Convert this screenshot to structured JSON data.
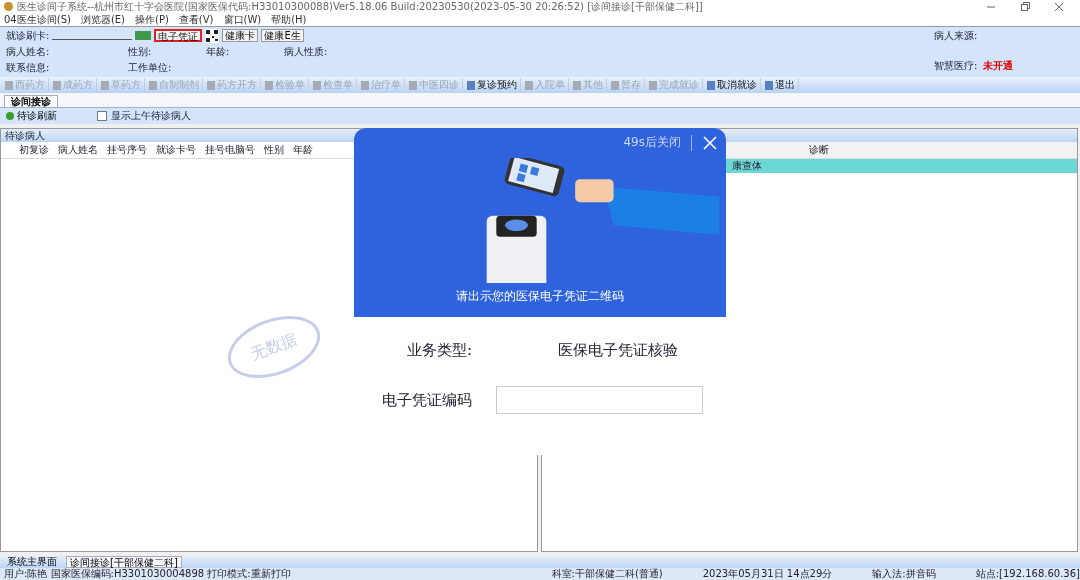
{
  "window": {
    "title": "医生诊间子系统--杭州市红十字会医院(国家医保代码:H33010300088)Ver5.18.06 Build:20230530(2023-05-30 20:26:52) [诊间接诊[干部保健二科]]"
  },
  "menu": [
    "04医生诊间(S)",
    "浏览器(E)",
    "操作(P)",
    "查看(V)",
    "窗口(W)",
    "帮助(H)"
  ],
  "patient_info": {
    "card_label": "就诊刷卡:",
    "card_buttons": [
      {
        "label": "电子凭证",
        "selected": true
      },
      {
        "label": "健康卡",
        "selected": false
      },
      {
        "label": "健康E生",
        "selected": false
      }
    ],
    "rows": [
      [
        {
          "label": "病人姓名:"
        },
        {
          "label": "性别:"
        },
        {
          "label": "年龄:"
        },
        {
          "label": "病人性质:"
        }
      ],
      [
        {
          "label": "联系信息:"
        },
        {
          "label": "工作单位:"
        }
      ]
    ],
    "source_label": "病人来源:",
    "smart_label": "智慧医疗:",
    "smart_value": "未开通"
  },
  "toolbar": [
    {
      "label": "西药方",
      "disabled": true
    },
    {
      "label": "成药方",
      "disabled": true
    },
    {
      "label": "草药方",
      "disabled": true
    },
    {
      "label": "自制制剂",
      "disabled": true
    },
    {
      "label": "药方开方",
      "disabled": true
    },
    {
      "label": "检验单",
      "disabled": true
    },
    {
      "label": "检查单",
      "disabled": true
    },
    {
      "label": "治疗单",
      "disabled": true
    },
    {
      "label": "中医四诊",
      "disabled": true
    },
    {
      "label": "复诊预约",
      "disabled": false
    },
    {
      "label": "入院单",
      "disabled": true
    },
    {
      "label": "其他",
      "disabled": true
    },
    {
      "label": "暂存",
      "disabled": true
    },
    {
      "label": "完成就诊",
      "disabled": true
    },
    {
      "label": "取消就诊",
      "disabled": false
    },
    {
      "label": "退出",
      "disabled": false
    }
  ],
  "tabs": [
    {
      "label": "诊间接诊",
      "selected": true
    }
  ],
  "refresh": "待诊刷新",
  "show_morning": {
    "label": "显示上午待诊病人",
    "checked": false
  },
  "left_panel": {
    "title": "待诊病人",
    "columns": [
      "初复诊",
      "病人姓名",
      "挂号序号",
      "就诊卡号",
      "挂号电脑号",
      "性别",
      "年龄"
    ],
    "empty_stamp": "无数据"
  },
  "right_panel": {
    "columns": [
      "诊断"
    ],
    "rows": [
      {
        "cells": [
          "康查体"
        ],
        "selected": true
      }
    ]
  },
  "dialog": {
    "countdown": "49s后关闭",
    "prompt": "请出示您的医保电子凭证二维码",
    "fields": [
      {
        "kind": "text",
        "label": "业务类型:",
        "value": "医保电子凭证核验"
      },
      {
        "kind": "input",
        "label": "电子凭证编码"
      }
    ]
  },
  "taskbar": [
    {
      "label": "系统主界面",
      "selected": false
    },
    {
      "label": "诊间接诊[干部保健二科]",
      "selected": true
    }
  ],
  "status_bar": [
    "用户:陈艳  国家医保编码:H3301030004898  打印模式:重新打印",
    "科室:干部保健二科(普通)",
    "2023年05月31日 14点29分",
    "输入法:拼音码",
    "站点:[192.168.60.36]"
  ]
}
